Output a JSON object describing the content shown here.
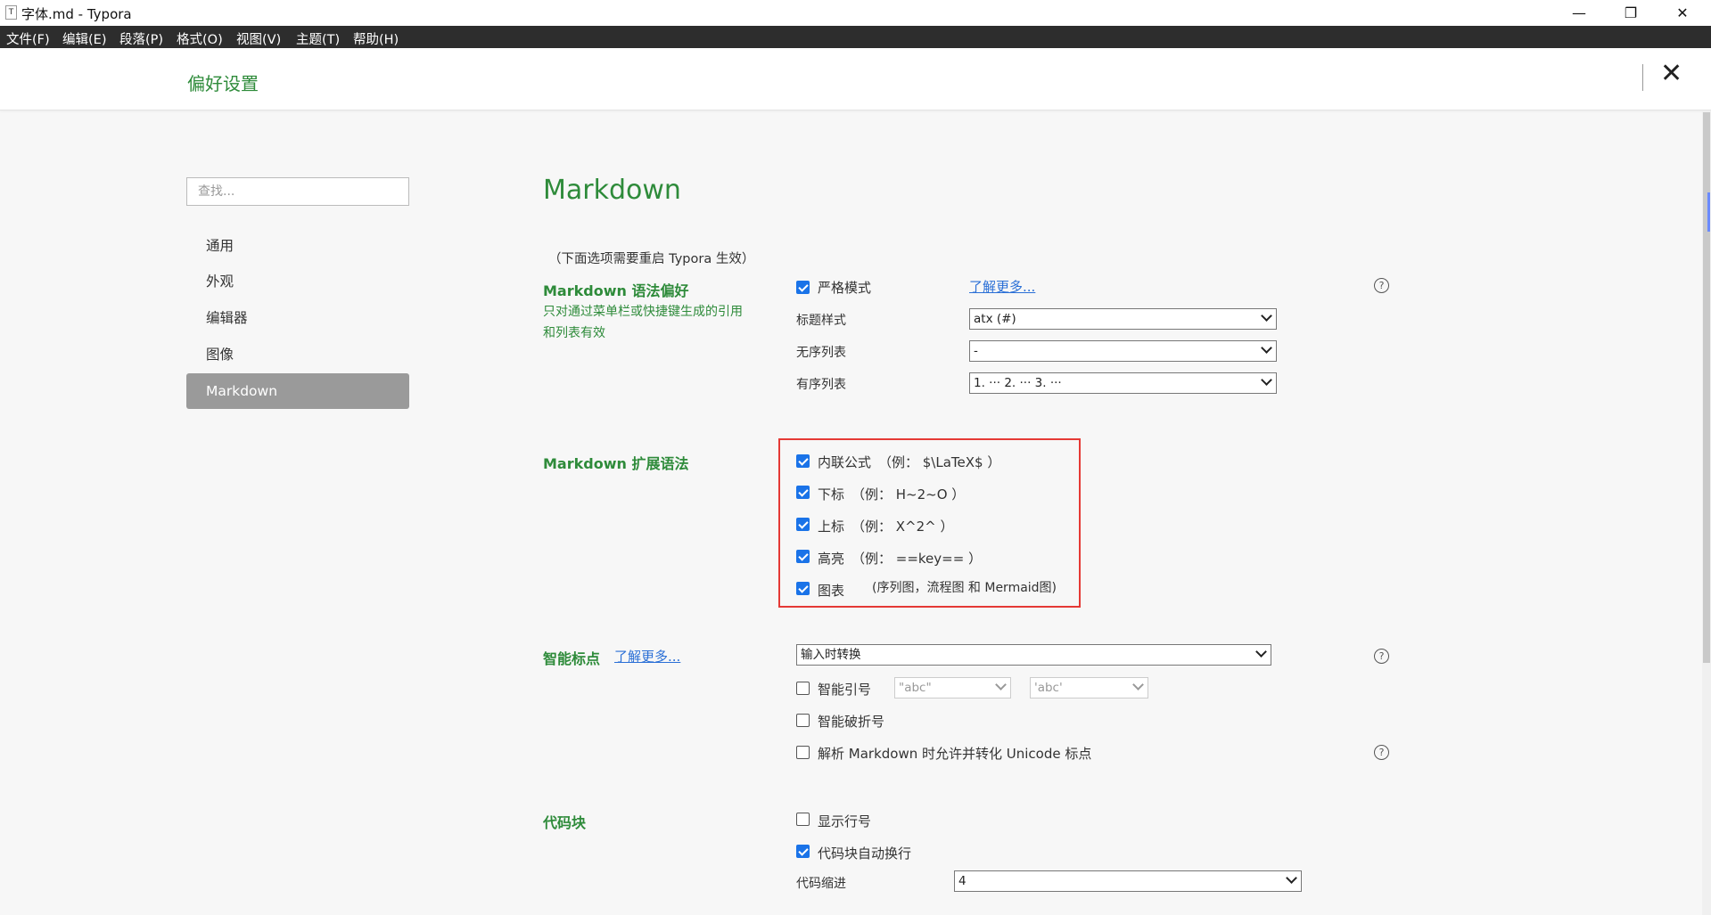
{
  "window": {
    "title": "字体.md - Typora",
    "app_icon": "T",
    "minimize": "—",
    "restore": "❐",
    "close": "✕"
  },
  "menu": [
    "文件(F)",
    "编辑(E)",
    "段落(P)",
    "格式(O)",
    "视图(V)",
    "主题(T)",
    "帮助(H)"
  ],
  "header": {
    "title": "偏好设置",
    "close": "✕"
  },
  "sidebar": {
    "search_placeholder": "查找...",
    "items": [
      {
        "label": "通用",
        "active": false
      },
      {
        "label": "外观",
        "active": false
      },
      {
        "label": "编辑器",
        "active": false
      },
      {
        "label": "图像",
        "active": false
      },
      {
        "label": "Markdown",
        "active": true
      }
    ]
  },
  "main": {
    "title": "Markdown",
    "note": "（下面选项需要重启 Typora 生效）",
    "syntax": {
      "heading": "Markdown 语法偏好",
      "desc_line1": "只对通过菜单栏或快捷键生成的引用",
      "desc_line2": "和列表有效",
      "strict_label": "严格模式",
      "strict_checked": true,
      "learn_more": "了解更多...",
      "heading_style_label": "标题样式",
      "heading_style_value": "atx (#)",
      "ul_label": "无序列表",
      "ul_value": "-",
      "ol_label": "有序列表",
      "ol_value": "1. ··· 2. ··· 3. ···"
    },
    "extended": {
      "heading": "Markdown 扩展语法",
      "items": [
        {
          "label": "内联公式",
          "example": "（例： $\\LaTeX$ ）",
          "checked": true
        },
        {
          "label": "下标",
          "example": "（例： H~2~O ）",
          "checked": true
        },
        {
          "label": "上标",
          "example": "（例： X^2^ ）",
          "checked": true
        },
        {
          "label": "高亮",
          "example": "（例： ==key== ）",
          "checked": true
        },
        {
          "label": "图表",
          "example": "(序列图，流程图 和 Mermaid图)",
          "checked": true
        }
      ]
    },
    "smart_punct": {
      "heading": "智能标点",
      "learn_more": "了解更多...",
      "mode_value": "输入时转换",
      "smart_quotes_label": "智能引号",
      "smart_quotes_checked": false,
      "double_quote_value": "\"abc\"",
      "single_quote_value": "'abc'",
      "smart_dash_label": "智能破折号",
      "smart_dash_checked": false,
      "unicode_label": "解析 Markdown 时允许并转化 Unicode 标点",
      "unicode_checked": false
    },
    "codeblock": {
      "heading": "代码块",
      "line_numbers_label": "显示行号",
      "line_numbers_checked": false,
      "wrap_label": "代码块自动换行",
      "wrap_checked": true,
      "indent_label": "代码缩进",
      "indent_value": "4"
    },
    "help_glyph": "?"
  },
  "colors": {
    "accent": "#2e8b3a",
    "link": "#2a6fd6",
    "checkbox": "#1a73e8",
    "highlight_box": "#e53935"
  }
}
